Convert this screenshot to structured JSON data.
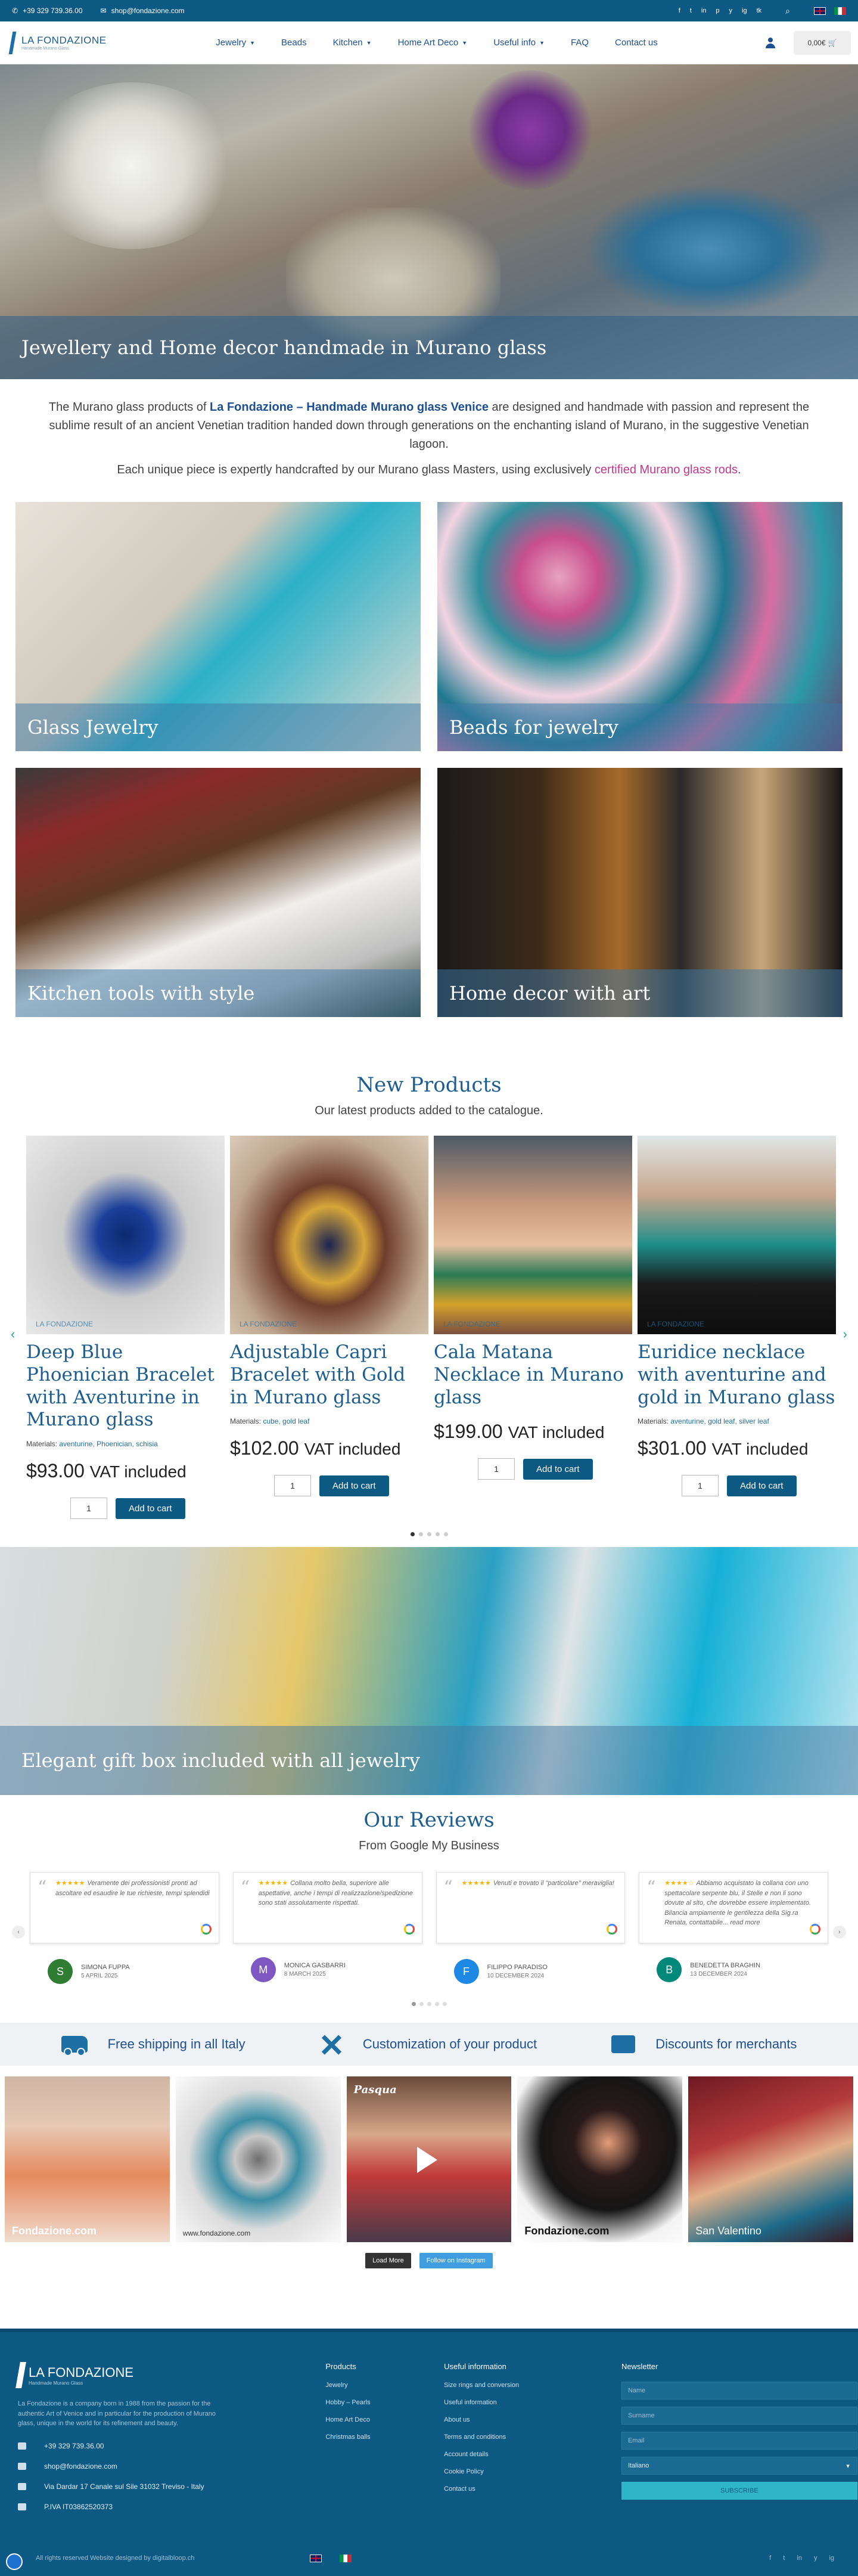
{
  "topbar": {
    "phone": "+39 329 739.36.00",
    "email": "shop@fondazione.com",
    "social": [
      "f",
      "t",
      "in",
      "p",
      "y",
      "ig",
      "tk"
    ],
    "search_icon": "search-icon"
  },
  "nav": {
    "logo_name": "LA FONDAZIONE",
    "logo_sub": "Handmade Murano Glass",
    "items": [
      "Jewelry",
      "Beads",
      "Kitchen",
      "Home Art Deco",
      "Useful info",
      "FAQ",
      "Contact us"
    ],
    "cart_total": "0,00€"
  },
  "hero": {
    "caption": "Jewellery and Home decor handmade in Murano glass"
  },
  "intro": {
    "p1_before": "The Murano glass products of ",
    "p1_brand": "La Fondazione – Handmade Murano glass Venice",
    "p1_after": " are designed and handmade with passion and represent the sublime result of an ancient Venetian tradition handed down through generations on the enchanting island of Murano, in the suggestive Venetian lagoon.",
    "p2_before": "Each unique piece is expertly handcrafted by our Murano glass Masters, using exclusively ",
    "p2_link": "certified Murano glass rods",
    "p2_after": "."
  },
  "categories": [
    {
      "label": "Glass Jewelry"
    },
    {
      "label": "Beads for jewelry"
    },
    {
      "label": "Kitchen tools with style"
    },
    {
      "label": "Home decor with art"
    }
  ],
  "new_products": {
    "title": "New Products",
    "subtitle": "Our latest products added to the catalogue.",
    "items": [
      {
        "name": "Deep Blue Phoenician Bracelet with Aventurine in Murano glass",
        "materials_label": "Materials: ",
        "materials": "aventurine, Phoenician, schisia",
        "price": "$93.00",
        "vat": "VAT included",
        "qty": "1",
        "cart": "Add to cart",
        "watermark": "LA FONDAZIONE"
      },
      {
        "name": "Adjustable Capri Bracelet with Gold in Murano glass",
        "materials_label": "Materials: ",
        "materials": "cube, gold leaf",
        "price": "$102.00",
        "vat": "VAT included",
        "qty": "1",
        "cart": "Add to cart",
        "watermark": "LA FONDAZIONE"
      },
      {
        "name": "Cala Matana Necklace in Murano glass",
        "materials_label": "",
        "materials": "",
        "price": "$199.00",
        "vat": "VAT included",
        "qty": "1",
        "cart": "Add to cart",
        "watermark": "LA FONDAZIONE"
      },
      {
        "name": "Euridice necklace with aventurine and gold in Murano glass",
        "materials_label": "Materials: ",
        "materials": "aventurine, gold leaf, silver leaf",
        "price": "$301.00",
        "vat": "VAT included",
        "qty": "1",
        "cart": "Add to cart",
        "watermark": "LA FONDAZIONE"
      }
    ],
    "active_dot": 0,
    "dot_count": 5
  },
  "gift": {
    "caption": "Elegant gift box included with all jewelry"
  },
  "reviews": {
    "title": "Our Reviews",
    "subtitle": "From Google My Business",
    "items": [
      {
        "stars": "★★★★★",
        "text": "Veramente dei professionisti pronti ad ascoltare ed esaudire le tue richieste, tempi splendidi",
        "initial": "S",
        "color": "#2e7d32",
        "author": "SIMONA FUPPA",
        "date": "5 APRIL 2025"
      },
      {
        "stars": "★★★★★",
        "text": "Collana molto bella, superiore alle aspettative, anche i tempi di realizzazione/spedizione sono stati assolutamente rispettati.",
        "initial": "M",
        "color": "#7e57c2",
        "author": "MONICA GASBARRI",
        "date": "8 MARCH 2025"
      },
      {
        "stars": "★★★★★",
        "text": "Venuti e trovato il \"particolare\" meraviglia!",
        "initial": "F",
        "color": "#1e88e5",
        "author": "FILIPPO PARADISO",
        "date": "10 DECEMBER 2024"
      },
      {
        "stars": "★★★★☆",
        "text": "Abbiamo acquistato la collana con uno spettacolare serpente blu, il Stelle e non li sono dovute al sito, che dovrebbe essere implementato. Bilancia ampiamente le gentilezza della Sig.ra Renata, contattabile... read more",
        "initial": "B",
        "color": "#00897b",
        "author": "BENEDETTA BRAGHIN",
        "date": "13 DECEMBER 2024"
      }
    ]
  },
  "features": [
    {
      "icon": "truck-icon",
      "label": "Free shipping in all Italy"
    },
    {
      "icon": "tools-icon",
      "label": "Customization of your product"
    },
    {
      "icon": "discount-icon",
      "label": "Discounts for merchants"
    }
  ],
  "instagram": {
    "captions": [
      "Fondazione.com",
      "www.fondazione.com",
      "Pasqua",
      "Fondazione.com",
      "San Valentino"
    ],
    "load_more": "Load More",
    "follow": "Follow on Instagram"
  },
  "footer": {
    "logo_name": "LA FONDAZIONE",
    "logo_sub": "Handmade Murano Glass",
    "description": "La Fondazione is a company born in 1988 from the passion for the authentic Art of Venice and in particular for the production of Murano glass, unique in the world for its refinement and beauty.",
    "phone": "+39 329 739.36.00",
    "email": "shop@fondazione.com",
    "address": "Via Dardar 17 Canale sul Sile 31032 Treviso - Italy",
    "vat": "P.IVA IT03862520373",
    "products_title": "Products",
    "products": [
      "Jewelry",
      "Hobby – Pearls",
      "Home Art Deco",
      "Christmas balls"
    ],
    "useful_title": "Useful information",
    "useful": [
      "Size rings and conversion",
      "Useful information",
      "About us",
      "Terms and conditions",
      "Account details",
      "Cookie Policy",
      "Contact us"
    ],
    "newsletter_title": "Newsletter",
    "name_ph": "Name",
    "surname_ph": "Surname",
    "email_ph": "Email",
    "lang": "Italiano",
    "subscribe": "SUBSCRIBE",
    "copyright": "All rights reserved Website designed by digitalbloop.ch"
  }
}
